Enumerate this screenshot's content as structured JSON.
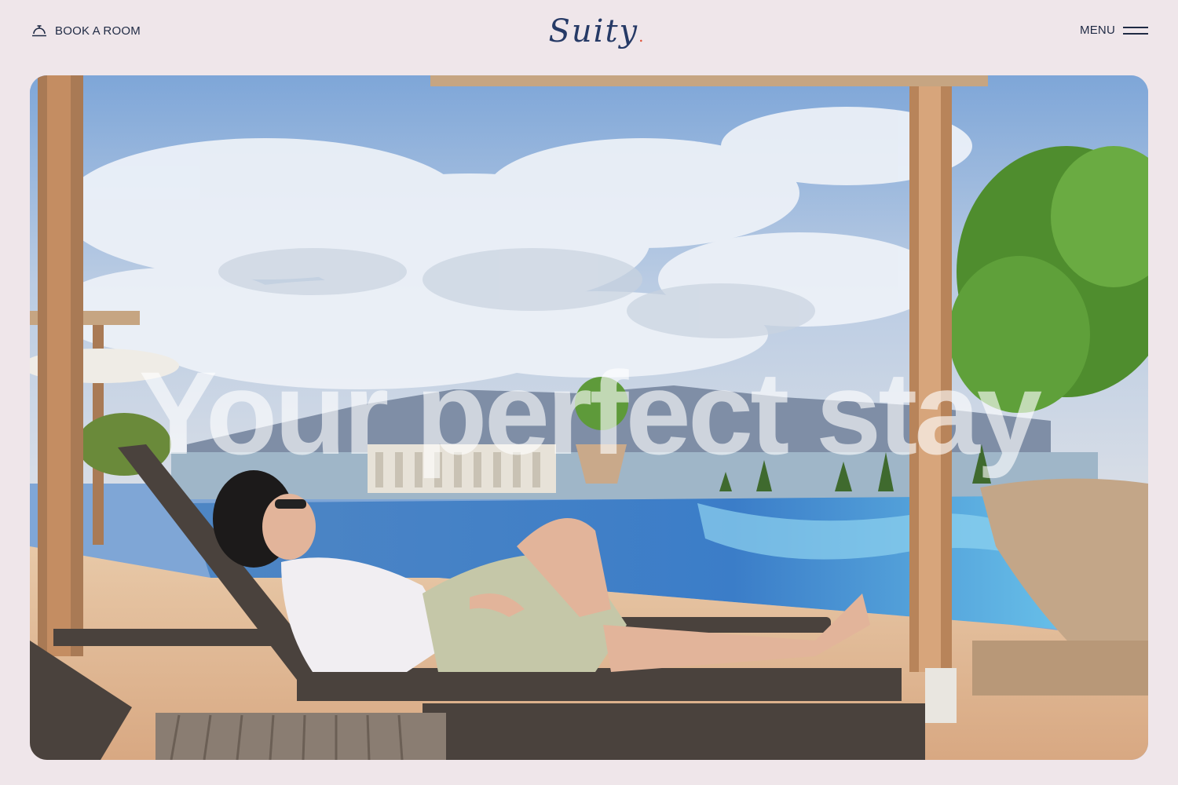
{
  "header": {
    "book_label": "BOOK A ROOM",
    "book_icon": "service-bell-icon",
    "logo_text": "Suity",
    "logo_dot": ".",
    "menu_label": "MENU",
    "menu_icon": "hamburger-icon"
  },
  "hero": {
    "headline": "Your perfect stay",
    "image": "woman-lounging-by-infinity-pool"
  },
  "colors": {
    "background": "#efe6ea",
    "text": "#1f2a44",
    "logo": "#263a66",
    "logo_accent": "#e0533b"
  }
}
